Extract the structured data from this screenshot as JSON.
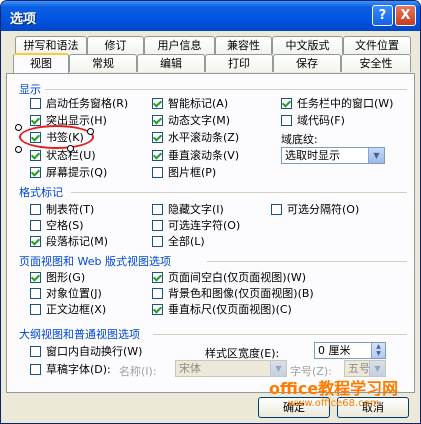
{
  "window": {
    "title": "选项",
    "help_glyph": "?",
    "close_glyph": "X"
  },
  "tabs_row1": [
    "拼写和语法",
    "修订",
    "用户信息",
    "兼容性",
    "中文版式",
    "文件位置"
  ],
  "tabs_row2": [
    "视图",
    "常规",
    "编辑",
    "打印",
    "保存",
    "安全性"
  ],
  "active_tab": "视图",
  "display": {
    "heading": "显示",
    "startup_taskpane": "启动任务窗格(R)",
    "highlight": "突出显示(H)",
    "bookmark": "书签(K)",
    "status_bar": "状态栏(U)",
    "screen_tips": "屏幕提示(Q)",
    "smart_tags": "智能标记(A)",
    "animated_text": "动态文字(M)",
    "hscroll": "水平滚动条(Z)",
    "vscroll": "垂直滚动条(V)",
    "picture_placeholder": "图片框(P)",
    "windows_in_taskbar": "任务栏中的窗口(W)",
    "field_codes": "域代码(F)",
    "field_shading_label": "域底纹:",
    "field_shading_value": "选取时显示"
  },
  "formatting": {
    "heading": "格式标记",
    "tab_chars": "制表符(T)",
    "spaces": "空格(S)",
    "paragraph_marks": "段落标记(M)",
    "hidden_text": "隐藏文字(I)",
    "optional_hyphens": "可选连字符(O)",
    "all": "全部(L)",
    "optional_breaks": "可选分隔符(O)"
  },
  "print_web": {
    "heading": "页面视图和 Web 版式视图选项",
    "drawings": "图形(G)",
    "object_anchors": "对象位置(J)",
    "text_boundaries": "正文边框(X)",
    "white_space": "页面间空白(仅页面视图)(W)",
    "background": "背景色和图像(仅页面视图)(B)",
    "vertical_ruler": "垂直标尺(仅页面视图)(C)"
  },
  "outline": {
    "heading": "大纲视图和普通视图选项",
    "wrap_to_window": "窗口内自动换行(W)",
    "draft_font": "草稿字体(D):",
    "name_label": "名称(I):",
    "name_value": "宋体",
    "style_width_label": "样式区宽度(E):",
    "style_width_value": "0 厘米",
    "size_label": "字号(Z):",
    "size_value": "五号"
  },
  "buttons": {
    "ok": "确定",
    "cancel": "取消"
  },
  "watermark": {
    "line1": "office教程学习网",
    "line2": "www.office68.com"
  }
}
